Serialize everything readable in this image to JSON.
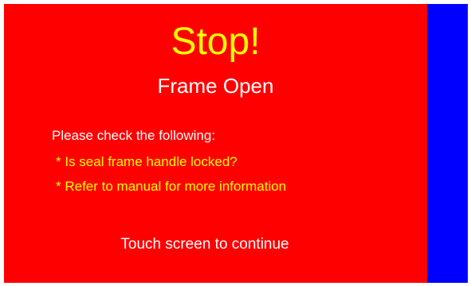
{
  "alert": {
    "title": "Stop!",
    "subtitle": "Frame Open",
    "instructions_label": "Please check the following:",
    "checks": [
      "* Is seal frame handle locked?",
      "* Refer to manual for more information"
    ],
    "touch_hint": "Touch screen to continue"
  },
  "colors": {
    "alert_background": "#ff0000",
    "side_bar": "#0000ff",
    "title_text": "#ffff00",
    "check_text": "#ffff00",
    "body_text": "#ffffff"
  }
}
